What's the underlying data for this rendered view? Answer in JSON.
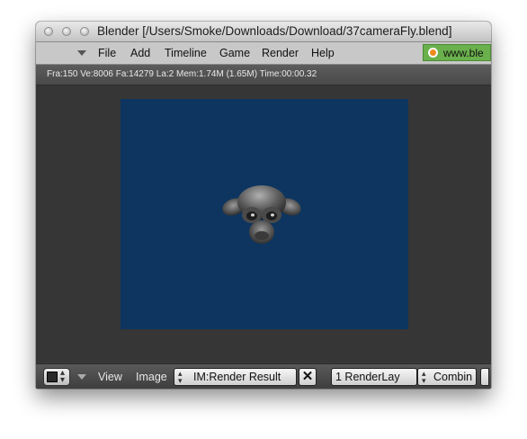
{
  "window": {
    "title": "Blender [/Users/Smoke/Downloads/Download/37cameraFly.blend]"
  },
  "menubar": {
    "items": [
      "File",
      "Add",
      "Timeline",
      "Game",
      "Render",
      "Help"
    ],
    "url_text": "www.ble"
  },
  "info": {
    "text": "Fra:150  Ve:8006 Fa:14279 La:2 Mem:1.74M (1.65M) Time:00:00.32"
  },
  "bottombar": {
    "menus": [
      "View",
      "Image"
    ],
    "image_field": "IM:Render Result",
    "close_label": "✕",
    "render_layer": "1 RenderLay",
    "pass_field": "Combin"
  },
  "colors": {
    "render_background": "#0d3560",
    "url_box": "#6ab04c",
    "viewport": "#363636"
  }
}
